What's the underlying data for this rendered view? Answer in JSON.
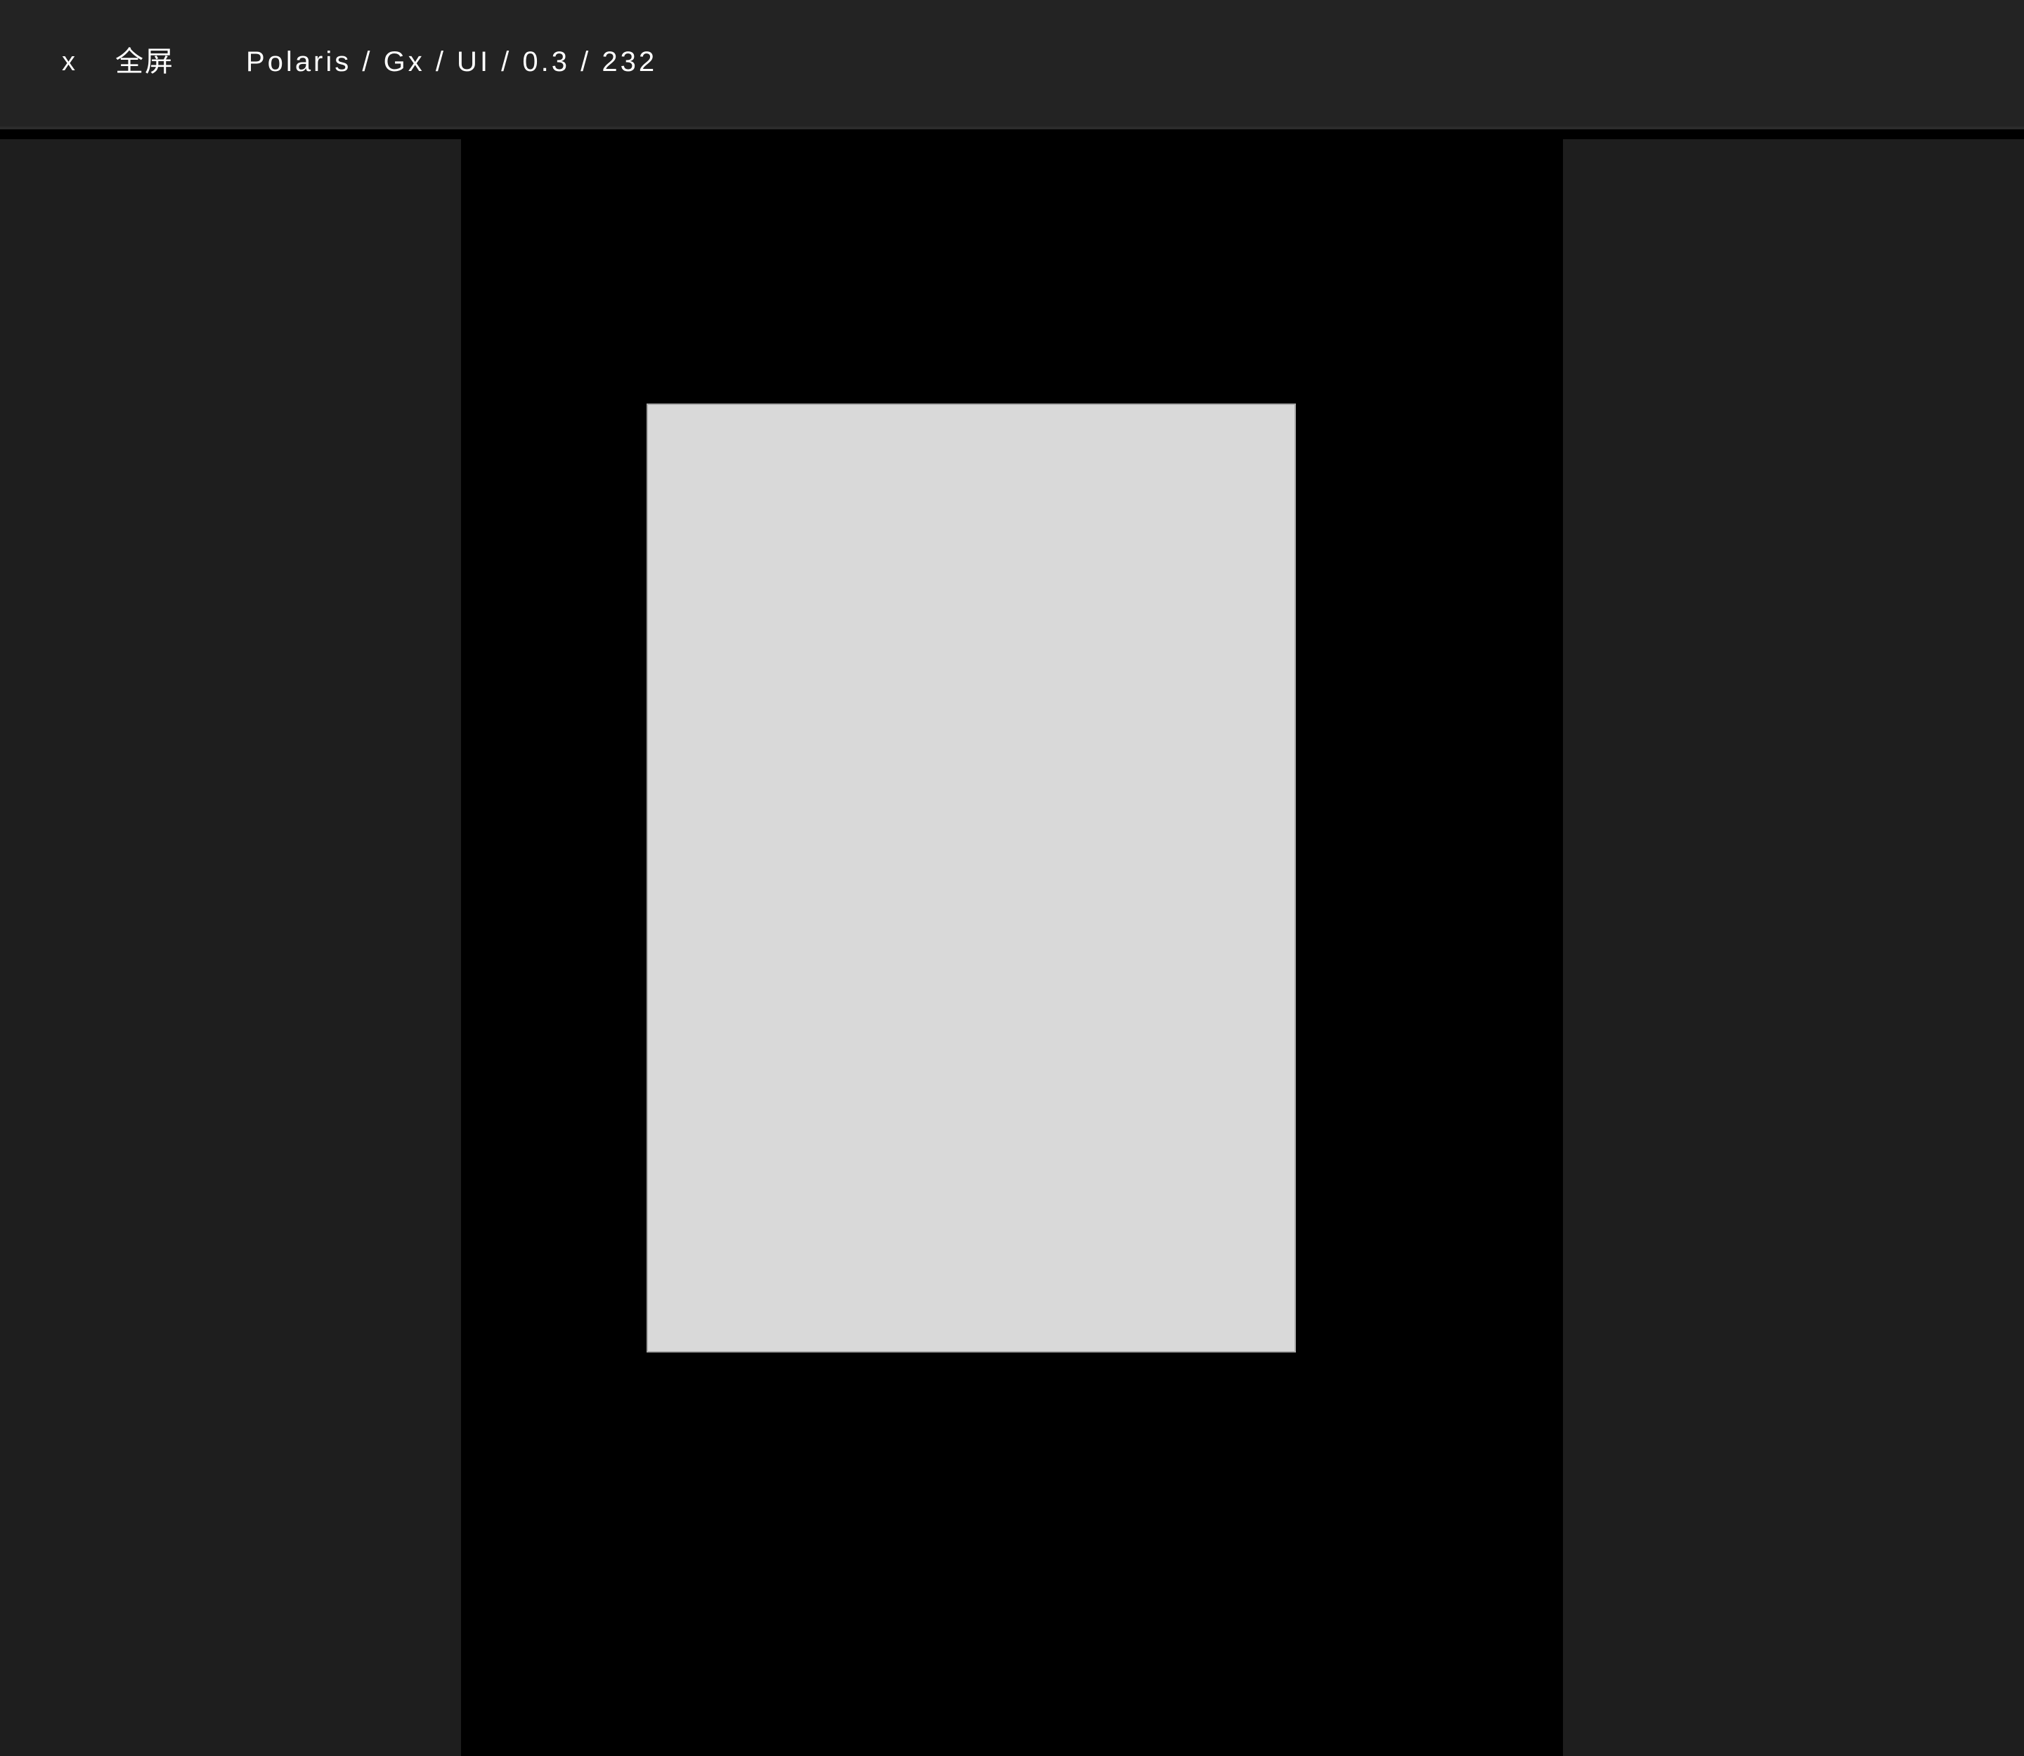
{
  "toolbar": {
    "close_label": "x",
    "fullscreen_label": "全屏",
    "breadcrumb": "Polaris / Gx / UI / 0.3 / 232"
  },
  "colors": {
    "toolbar_bg": "#232323",
    "side_panel_bg": "#1e1e1e",
    "canvas_bg": "#000000",
    "frame_fill": "#d9d9d9",
    "text": "#ffffff"
  }
}
